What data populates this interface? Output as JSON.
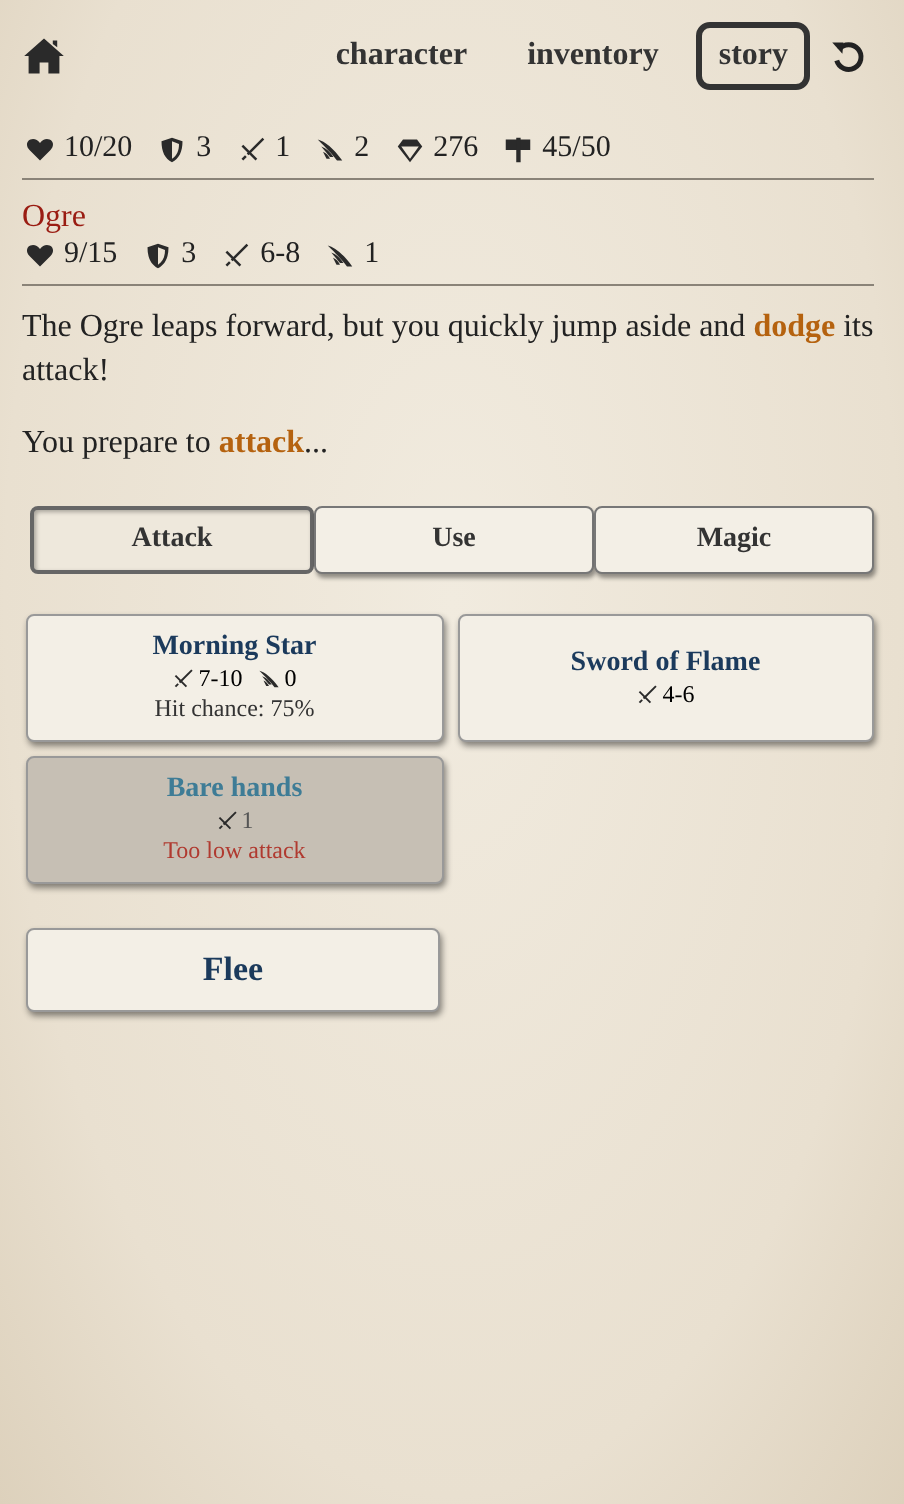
{
  "nav": {
    "links": [
      {
        "label": "character",
        "selected": false
      },
      {
        "label": "inventory",
        "selected": false
      },
      {
        "label": "story",
        "selected": true
      }
    ]
  },
  "player_stats": [
    {
      "kind": "health",
      "value": "10/20"
    },
    {
      "kind": "armor",
      "value": "3"
    },
    {
      "kind": "attack",
      "value": "1"
    },
    {
      "kind": "agility",
      "value": "2"
    },
    {
      "kind": "gold",
      "value": "276"
    },
    {
      "kind": "progress",
      "value": "45/50"
    }
  ],
  "enemy": {
    "name": "Ogre",
    "stats": [
      {
        "kind": "health",
        "value": "9/15"
      },
      {
        "kind": "armor",
        "value": "3"
      },
      {
        "kind": "attack",
        "value": "6-8"
      },
      {
        "kind": "agility",
        "value": "1"
      }
    ]
  },
  "story": [
    "The Ogre leaps forward, but you quickly jump aside and **dodge** its attack!",
    "You prepare to **attack**..."
  ],
  "tabs": [
    {
      "label": "Attack",
      "selected": true
    },
    {
      "label": "Use",
      "selected": false
    },
    {
      "label": "Magic",
      "selected": false
    }
  ],
  "weapons": [
    {
      "name": "Morning Star",
      "disabled": false,
      "stats": [
        {
          "kind": "attack",
          "value": "7-10"
        },
        {
          "kind": "agility",
          "value": "0"
        }
      ],
      "note": "Hit chance: 75%"
    },
    {
      "name": "Sword of Flame",
      "disabled": false,
      "stats": [
        {
          "kind": "attack",
          "value": "4-6"
        }
      ]
    },
    {
      "name": "Bare hands",
      "disabled": true,
      "stats": [
        {
          "kind": "attack",
          "value": "1"
        }
      ],
      "note": "Too low attack"
    }
  ],
  "flee": {
    "label": "Flee"
  }
}
